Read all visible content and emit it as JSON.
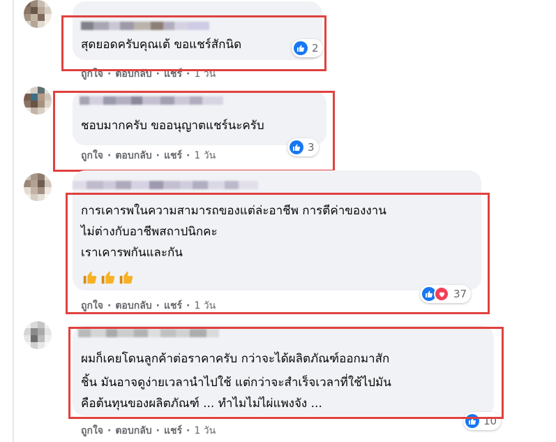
{
  "comments": [
    {
      "lines": [
        "สุดยอดครับคุณเต้ ขอแชร์สักนิด"
      ],
      "reaction_count": "2",
      "actions": {
        "like": "ถูกใจ",
        "reply": "ตอบกลับ",
        "share": "แชร์",
        "time": "1 วัน"
      }
    },
    {
      "lines": [
        "ชอบมากครับ ขออนุญาตแชร์นะครับ"
      ],
      "reaction_count": "3",
      "actions": {
        "like": "ถูกใจ",
        "reply": "ตอบกลับ",
        "share": "แชร์",
        "time": "1 วัน"
      }
    },
    {
      "lines": [
        "การเคารพในความสามารถของแต่ล่ะอาชีพ การตีค่าของงาน",
        "ไม่ต่างกับอาชีพสถาปนิกคะ",
        "เราเคารพกันและกัน"
      ],
      "emoji": [
        "thumbs-up-icon",
        "thumbs-up-icon",
        "thumbs-up-icon"
      ],
      "reaction_count": "37",
      "actions": {
        "like": "ถูกใจ",
        "reply": "ตอบกลับ",
        "share": "แชร์",
        "time": "1 วัน"
      }
    },
    {
      "lines": [
        "ผมก็เคยโดนลูกค้าต่อราคาครับ กว่าจะได้ผลิตภัณฑ์ออกมาสัก",
        "ชิ้น มันอาจดูง่ายเวลานำไปใช้ แต่กว่าจะสำเร็จเวลาที่ใช้ไปมัน",
        "คือต้นทุนของผลิตภัณฑ์ ... ทำไมไม่ไผ่แพงจัง ..."
      ],
      "reaction_count": "10",
      "actions": {
        "like": "ถูกใจ",
        "reply": "ตอบกลับ",
        "share": "แชร์",
        "time": "1 วัน"
      }
    }
  ],
  "separator": "·",
  "colors": {
    "bubble": "#f0f2f5",
    "highlight": "#e0413f",
    "like_blue": "#1877f2",
    "love_red": "#f33e58",
    "meta_gray": "#65676b"
  }
}
